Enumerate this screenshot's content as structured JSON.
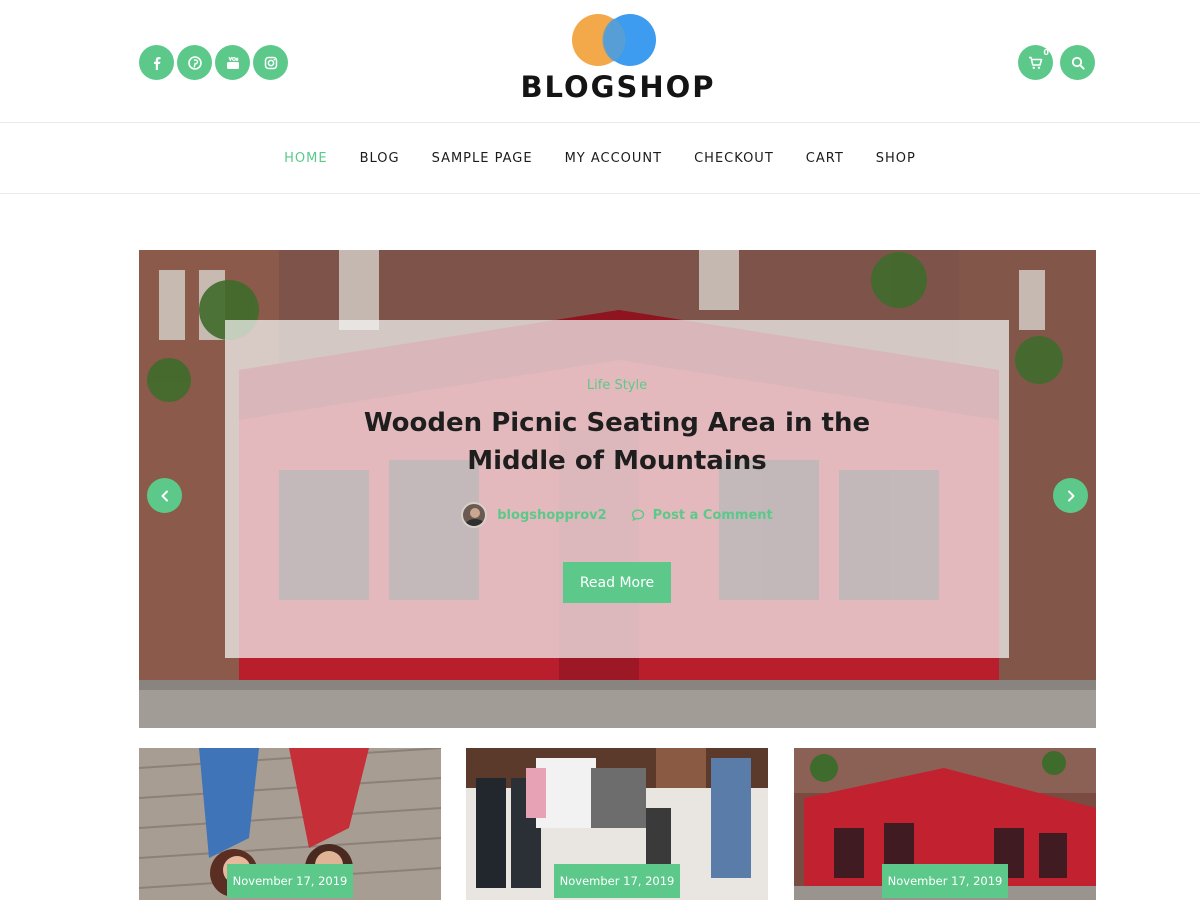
{
  "site": {
    "title": "BLOGSHOP",
    "brand_colors": {
      "accent": "#5cc98a",
      "logo_orange": "#f3a94a",
      "logo_blue": "#3d9cf0"
    }
  },
  "header": {
    "social_icons": [
      "facebook-icon",
      "pinterest-icon",
      "youtube-icon",
      "instagram-icon"
    ],
    "cart_count": "0",
    "action_icons": [
      "cart-icon",
      "search-icon"
    ]
  },
  "nav": {
    "items": [
      {
        "label": "HOME",
        "active": true
      },
      {
        "label": "BLOG",
        "active": false
      },
      {
        "label": "SAMPLE PAGE",
        "active": false
      },
      {
        "label": "MY ACCOUNT",
        "active": false
      },
      {
        "label": "CHECKOUT",
        "active": false
      },
      {
        "label": "CART",
        "active": false
      },
      {
        "label": "SHOP",
        "active": false
      }
    ]
  },
  "slider": {
    "category": "Life Style",
    "title": "Wooden Picnic Seating Area in the Middle of Mountains",
    "author": "blogshopprov2",
    "comment_label": "Post a Comment",
    "read_more_label": "Read More",
    "prev_icon": "chevron-left-icon",
    "next_icon": "chevron-right-icon"
  },
  "posts": [
    {
      "date": "November 17, 2019"
    },
    {
      "date": "November 17, 2019"
    },
    {
      "date": "November 17, 2019"
    }
  ]
}
